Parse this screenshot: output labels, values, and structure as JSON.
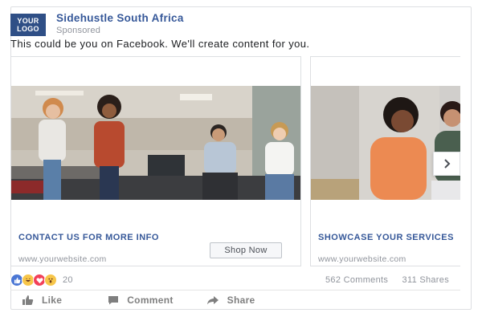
{
  "page": {
    "logo_line1": "YOUR",
    "logo_line2": "LOGO",
    "name": "Sidehustle South Africa",
    "sponsored": "Sponsored"
  },
  "post": {
    "caption": "This could be you on Facebook. We'll create content for you."
  },
  "carousel": {
    "cards": [
      {
        "title": "CONTACT US FOR MORE INFO",
        "url": "www.yourwebsite.com",
        "cta": "Shop Now"
      },
      {
        "title": "SHOWCASE YOUR SERVICES",
        "url": "www.yourwebsite.com"
      }
    ],
    "next_icon": "chevron-right-icon"
  },
  "stats": {
    "reactions": [
      "like-icon",
      "haha-icon",
      "love-icon",
      "wow-icon"
    ],
    "reaction_count": "20",
    "comments": "562 Comments",
    "shares": "311 Shares"
  },
  "actions": {
    "like": "Like",
    "comment": "Comment",
    "share": "Share"
  },
  "colors": {
    "brand_blue": "#365899",
    "logo_bg": "#2f4f86",
    "muted_text": "#90949c"
  }
}
